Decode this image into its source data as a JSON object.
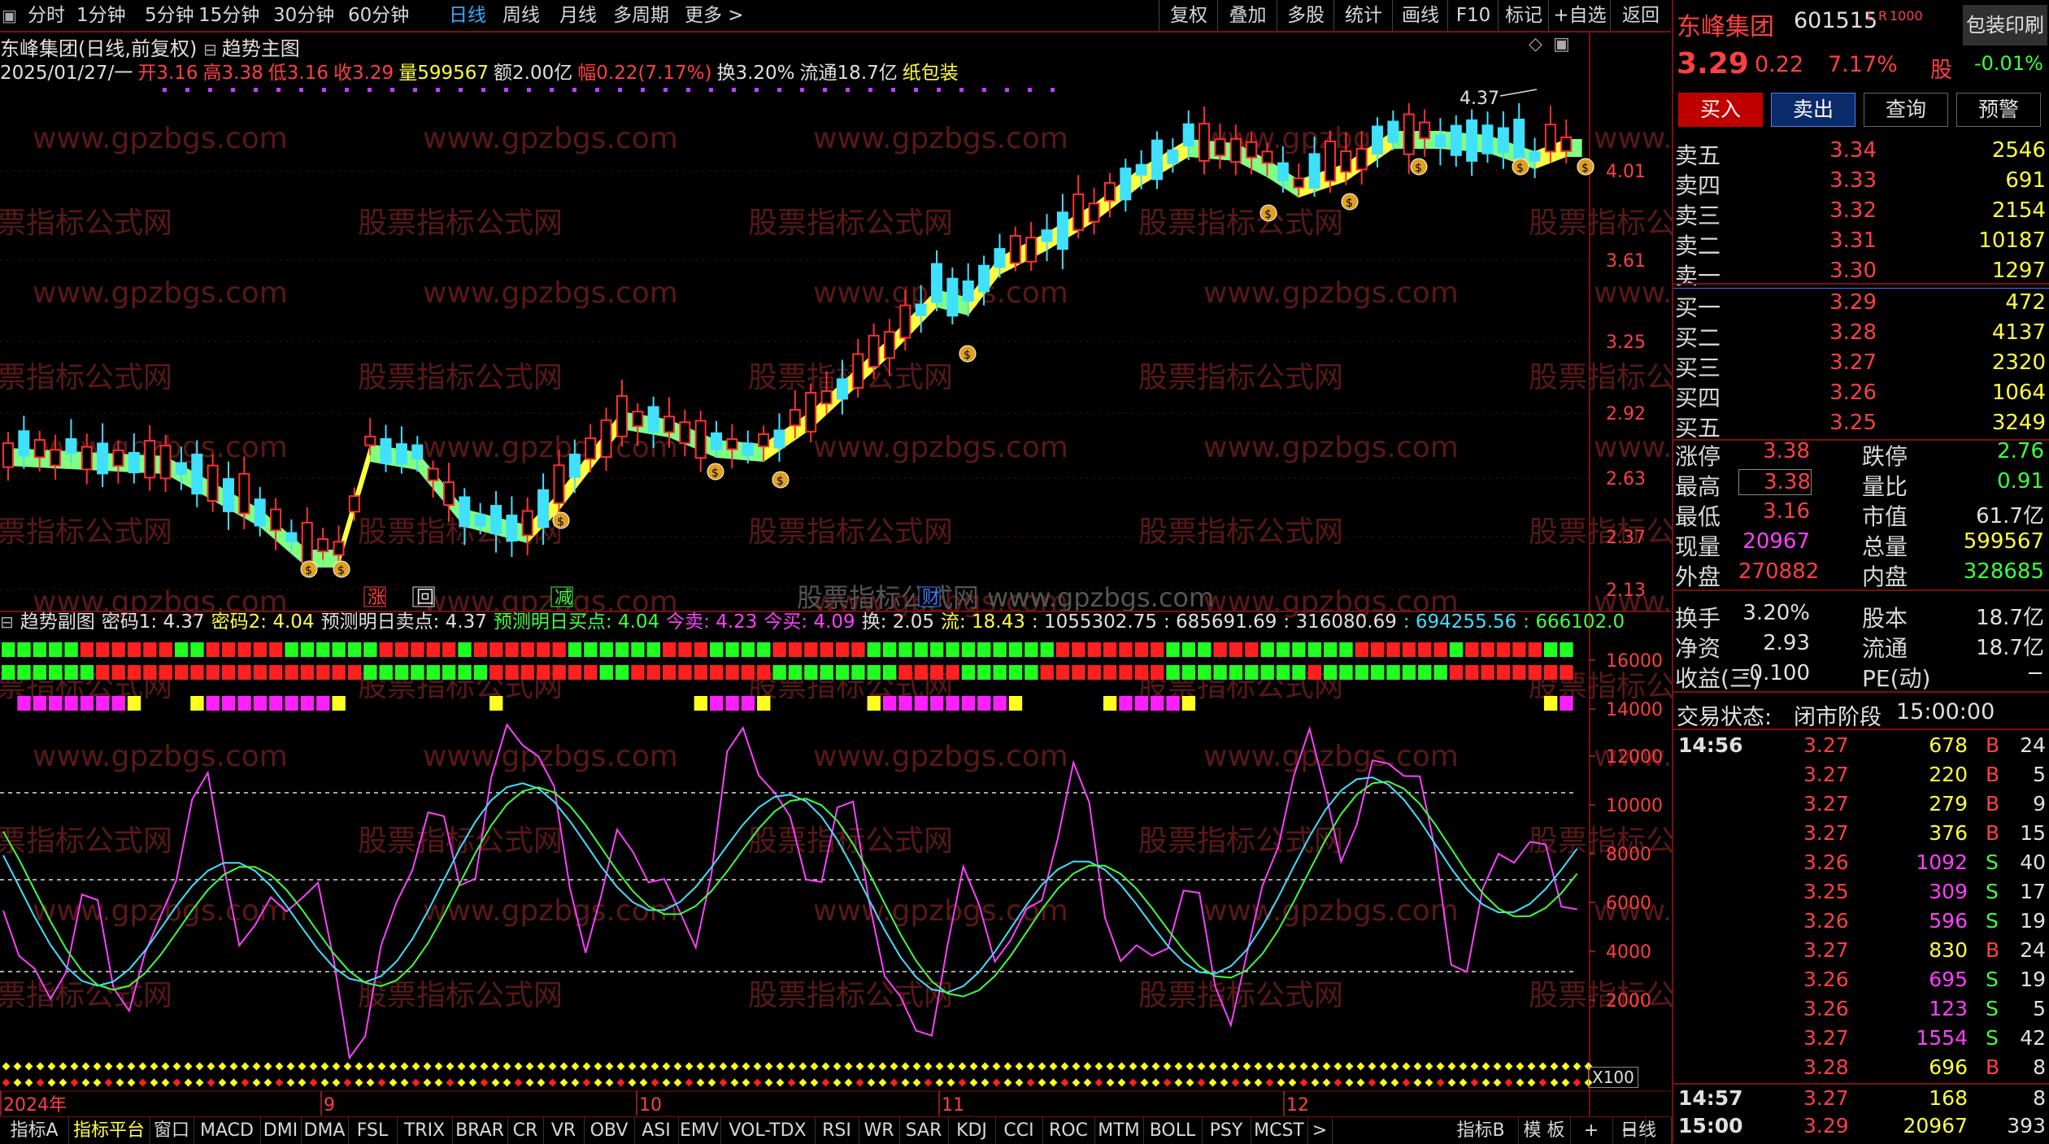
{
  "toolbar": {
    "periods": [
      "分时",
      "1分钟",
      "5分钟",
      "15分钟",
      "30分钟",
      "60分钟",
      "日线",
      "周线",
      "月线",
      "多周期",
      "更多 >"
    ],
    "active_period": "日线",
    "right_buttons": [
      "复权",
      "叠加",
      "多股",
      "统计",
      "画线",
      "F10",
      "标记",
      "+自选",
      "返回"
    ]
  },
  "chart": {
    "window_title": "东峰集团(日线,前复权)",
    "main_indicator": "趋势主图",
    "date": "2025/01/27/一",
    "open_label": "开",
    "open": "3.16",
    "high_label": "高",
    "high": "3.38",
    "low_label": "低",
    "low": "3.16",
    "close_label": "收",
    "close": "3.29",
    "vol_label": "量",
    "vol": "599567",
    "amt_label": "额",
    "amt": "2.00亿",
    "chg_label": "幅",
    "chg": "0.22(7.17%)",
    "turn_label": "换",
    "turn": "3.20%",
    "float_label": "流通",
    "float": "18.7亿",
    "concept": "纸包装",
    "marker_label": "4.37",
    "signals": [
      "涨",
      "回",
      "减",
      "财"
    ],
    "watermark_url": "www.gpzbgs.com",
    "watermark_text": "股票指标公式网",
    "center_watermark": "股票指标公式网 www.gpzbgs.com"
  },
  "price_axis": [
    "4.01",
    "3.61",
    "3.25",
    "2.92",
    "2.63",
    "2.37",
    "2.13"
  ],
  "sub": {
    "title": "趋势副图",
    "items": [
      {
        "text": "密码1: 4.37",
        "color": "#e0e0e0"
      },
      {
        "text": "密码2: 4.04",
        "color": "#ffff40"
      },
      {
        "text": "预测明日卖点: 4.37",
        "color": "#e0e0e0"
      },
      {
        "text": "预测明日买点: 4.04",
        "color": "#40ff40"
      },
      {
        "text": "今卖: 4.23",
        "color": "#ff40ff"
      },
      {
        "text": "今买: 4.09",
        "color": "#ff40ff"
      },
      {
        "text": "换: 2.05",
        "color": "#e0e0e0"
      },
      {
        "text": "流: 18.43",
        "color": "#ffff40"
      },
      {
        "text": ": 1055302.75",
        "color": "#e0e0e0"
      },
      {
        "text": ": 685691.69",
        "color": "#e0e0e0"
      },
      {
        "text": ": 316080.69",
        "color": "#e0e0e0"
      },
      {
        "text": ": 694255.56",
        "color": "#40e0ff"
      },
      {
        "text": ": 666102.0",
        "color": "#40ff40"
      }
    ],
    "axis": [
      "16000",
      "14000",
      "12000",
      "10000",
      "8000",
      "6000",
      "4000",
      "2000"
    ],
    "x100": "X100"
  },
  "date_axis": [
    "2024年",
    "9",
    "10",
    "11",
    "12"
  ],
  "bottom_tabs": [
    "指标A",
    "指标平台",
    "窗口",
    "MACD",
    "DMI",
    "DMA",
    "FSL",
    "TRIX",
    "BRAR",
    "CR",
    "VR",
    "OBV",
    "ASI",
    "EMV",
    "VOL-TDX",
    "RSI",
    "WR",
    "SAR",
    "KDJ",
    "CCI",
    "ROC",
    "MTM",
    "BOLL",
    "PSY",
    "MCST",
    ">",
    "指标B",
    "模 板",
    "+",
    "−",
    "日线"
  ],
  "quote": {
    "name": "东峰集团",
    "code": "601515",
    "flags": "L R",
    "flag2": "1000",
    "industry": "包装印刷",
    "price": "3.29",
    "change": "0.22",
    "pct": "7.17%",
    "industry_label": "股",
    "industry_pct": "-0.01%",
    "buttons": [
      "买入",
      "卖出",
      "查询",
      "预警"
    ],
    "asks": [
      {
        "label": "卖五",
        "price": "3.34",
        "vol": "2546"
      },
      {
        "label": "卖四",
        "price": "3.33",
        "vol": "691"
      },
      {
        "label": "卖三",
        "price": "3.32",
        "vol": "2154"
      },
      {
        "label": "卖二",
        "price": "3.31",
        "vol": "10187"
      },
      {
        "label": "卖一",
        "price": "3.30",
        "vol": "1297"
      }
    ],
    "bids": [
      {
        "label": "买一",
        "price": "3.29",
        "vol": "472"
      },
      {
        "label": "买二",
        "price": "3.28",
        "vol": "4137"
      },
      {
        "label": "买三",
        "price": "3.27",
        "vol": "2320"
      },
      {
        "label": "买四",
        "price": "3.26",
        "vol": "1064"
      },
      {
        "label": "买五",
        "price": "3.25",
        "vol": "3249"
      }
    ],
    "stats": [
      {
        "k1": "涨停",
        "v1": "3.38",
        "c1": "#ff4040",
        "k2": "跌停",
        "v2": "2.76",
        "c2": "#40ff40"
      },
      {
        "k1": "最高",
        "v1": "3.38",
        "c1": "#ff4040",
        "k2": "量比",
        "v2": "0.91",
        "c2": "#40ff40"
      },
      {
        "k1": "最低",
        "v1": "3.16",
        "c1": "#ff4040",
        "k2": "市值",
        "v2": "61.7亿",
        "c2": "#e0e0e0"
      },
      {
        "k1": "现量",
        "v1": "20967",
        "c1": "#ff40ff",
        "k2": "总量",
        "v2": "599567",
        "c2": "#ffff40"
      },
      {
        "k1": "外盘",
        "v1": "270882",
        "c1": "#ff4040",
        "k2": "内盘",
        "v2": "328685",
        "c2": "#40ff40"
      },
      {
        "k1": "换手",
        "v1": "3.20%",
        "c1": "#e0e0e0",
        "k2": "股本",
        "v2": "18.7亿",
        "c2": "#e0e0e0"
      },
      {
        "k1": "净资",
        "v1": "2.93",
        "c1": "#e0e0e0",
        "k2": "流通",
        "v2": "18.7亿",
        "c2": "#e0e0e0"
      },
      {
        "k1": "收益(三)",
        "v1": "-0.100",
        "c1": "#e0e0e0",
        "k2": "PE(动)",
        "v2": "−",
        "c2": "#e0e0e0"
      }
    ],
    "trade_status_label": "交易状态:",
    "trade_status": "闭市阶段",
    "trade_time": "15:00:00",
    "ticks": [
      {
        "time": "14:56",
        "price": "3.27",
        "vol": "678",
        "bs": "B",
        "n": "24"
      },
      {
        "time": "",
        "price": "3.27",
        "vol": "220",
        "bs": "B",
        "n": "5"
      },
      {
        "time": "",
        "price": "3.27",
        "vol": "279",
        "bs": "B",
        "n": "9"
      },
      {
        "time": "",
        "price": "3.27",
        "vol": "376",
        "bs": "B",
        "n": "15"
      },
      {
        "time": "",
        "price": "3.26",
        "vol": "1092",
        "bs": "S",
        "n": "40"
      },
      {
        "time": "",
        "price": "3.25",
        "vol": "309",
        "bs": "S",
        "n": "17"
      },
      {
        "time": "",
        "price": "3.26",
        "vol": "596",
        "bs": "S",
        "n": "19"
      },
      {
        "time": "",
        "price": "3.27",
        "vol": "830",
        "bs": "B",
        "n": "24"
      },
      {
        "time": "",
        "price": "3.26",
        "vol": "695",
        "bs": "S",
        "n": "19"
      },
      {
        "time": "",
        "price": "3.26",
        "vol": "123",
        "bs": "S",
        "n": "5"
      },
      {
        "time": "",
        "price": "3.27",
        "vol": "1554",
        "bs": "S",
        "n": "42"
      },
      {
        "time": "",
        "price": "3.28",
        "vol": "696",
        "bs": "B",
        "n": "8"
      },
      {
        "time": "14:57",
        "price": "3.27",
        "vol": "168",
        "bs": "",
        "n": "8"
      },
      {
        "time": "15:00",
        "price": "3.29",
        "vol": "20967",
        "bs": "",
        "n": "393"
      }
    ]
  }
}
